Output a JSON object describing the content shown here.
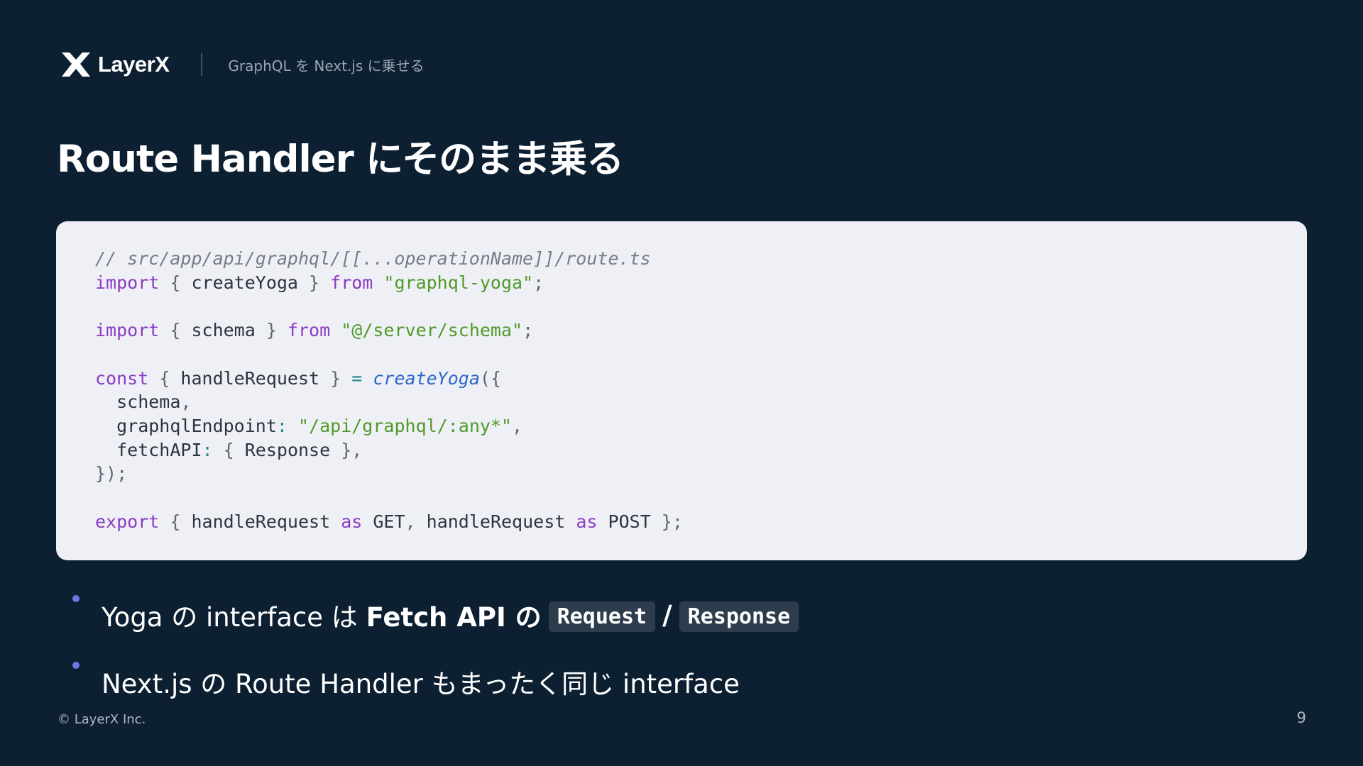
{
  "header": {
    "logo_text": "LayerX",
    "logo_icon": "layerx-logo-icon",
    "subtitle": "GraphQL を Next.js に乗せる"
  },
  "title": "Route Handler にそのまま乗る",
  "code": {
    "language": "typescript",
    "lines": [
      [
        {
          "t": "comment",
          "v": "// src/app/api/graphql/[[...operationName]]/route.ts"
        }
      ],
      [
        {
          "t": "keyword",
          "v": "import"
        },
        {
          "t": "punct",
          "v": " { "
        },
        {
          "t": "ident",
          "v": "createYoga"
        },
        {
          "t": "punct",
          "v": " } "
        },
        {
          "t": "keyword",
          "v": "from"
        },
        {
          "t": "ident",
          "v": " "
        },
        {
          "t": "string",
          "v": "\"graphql-yoga\""
        },
        {
          "t": "punct",
          "v": ";"
        }
      ],
      [],
      [
        {
          "t": "keyword",
          "v": "import"
        },
        {
          "t": "punct",
          "v": " { "
        },
        {
          "t": "ident",
          "v": "schema"
        },
        {
          "t": "punct",
          "v": " } "
        },
        {
          "t": "keyword",
          "v": "from"
        },
        {
          "t": "ident",
          "v": " "
        },
        {
          "t": "string",
          "v": "\"@/server/schema\""
        },
        {
          "t": "punct",
          "v": ";"
        }
      ],
      [],
      [
        {
          "t": "keyword",
          "v": "const"
        },
        {
          "t": "punct",
          "v": " { "
        },
        {
          "t": "ident",
          "v": "handleRequest"
        },
        {
          "t": "punct",
          "v": " } "
        },
        {
          "t": "op",
          "v": "="
        },
        {
          "t": "ident",
          "v": " "
        },
        {
          "t": "func",
          "v": "createYoga"
        },
        {
          "t": "punct",
          "v": "({"
        }
      ],
      [
        {
          "t": "ident",
          "v": "  schema"
        },
        {
          "t": "punct",
          "v": ","
        }
      ],
      [
        {
          "t": "ident",
          "v": "  graphqlEndpoint"
        },
        {
          "t": "op",
          "v": ":"
        },
        {
          "t": "ident",
          "v": " "
        },
        {
          "t": "string",
          "v": "\"/api/graphql/:any*\""
        },
        {
          "t": "punct",
          "v": ","
        }
      ],
      [
        {
          "t": "ident",
          "v": "  fetchAPI"
        },
        {
          "t": "op",
          "v": ":"
        },
        {
          "t": "punct",
          "v": " { "
        },
        {
          "t": "ident",
          "v": "Response"
        },
        {
          "t": "punct",
          "v": " },"
        }
      ],
      [
        {
          "t": "punct",
          "v": "});"
        }
      ],
      [],
      [
        {
          "t": "keyword",
          "v": "export"
        },
        {
          "t": "punct",
          "v": " { "
        },
        {
          "t": "ident",
          "v": "handleRequest"
        },
        {
          "t": "ident",
          "v": " "
        },
        {
          "t": "keyword",
          "v": "as"
        },
        {
          "t": "ident",
          "v": " GET"
        },
        {
          "t": "punct",
          "v": ", "
        },
        {
          "t": "ident",
          "v": "handleRequest"
        },
        {
          "t": "ident",
          "v": " "
        },
        {
          "t": "keyword",
          "v": "as"
        },
        {
          "t": "ident",
          "v": " POST"
        },
        {
          "t": "punct",
          "v": " };"
        }
      ]
    ]
  },
  "bullets": {
    "first": {
      "prefix": "Yoga の interface は ",
      "bold": "Fetch API の",
      "code_request": "Request",
      "separator": "/",
      "code_response": "Response"
    },
    "second": {
      "text": "Next.js の Route Handler もまったく同じ interface"
    }
  },
  "footer": {
    "copyright": "© LayerX Inc.",
    "page_number": "9"
  },
  "colors": {
    "background": "#0c2031",
    "code_background": "#eff0f5",
    "bullet_dot": "#6f76e8",
    "inline_code_background": "#2e3d4d"
  }
}
